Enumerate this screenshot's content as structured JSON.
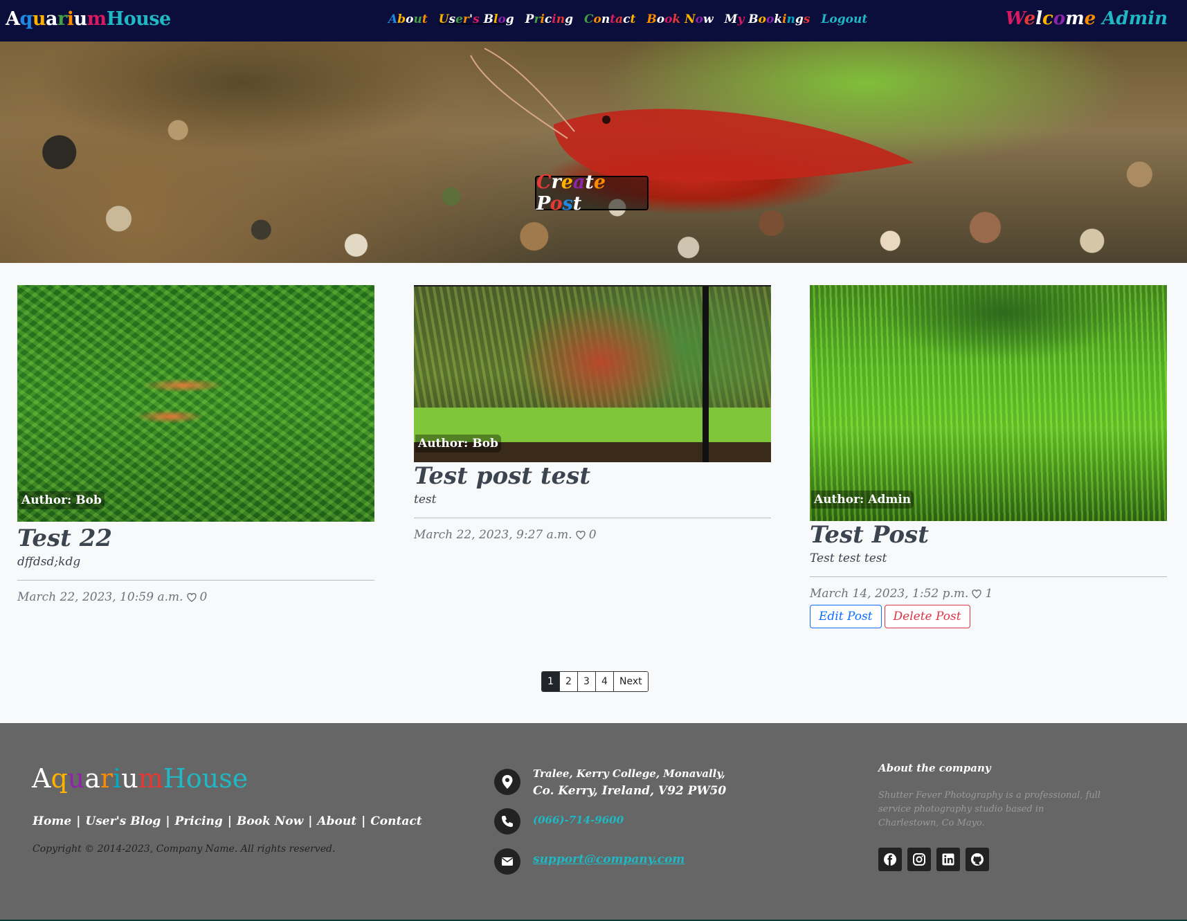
{
  "brand": {
    "part1": "Aquarium",
    "part2": "House"
  },
  "nav": {
    "items": [
      "About",
      "User's Blog",
      "Pricing",
      "Contact",
      "Book Now",
      "My Bookings",
      "Logout"
    ],
    "active_index": 1
  },
  "welcome": {
    "greeting": "Welcome",
    "user": "Admin"
  },
  "hero": {
    "create_post_label": "Create Post"
  },
  "posts": [
    {
      "author": "Author: Bob",
      "title": "Test 22",
      "excerpt": "dffdsd;kdg",
      "date": "March 22, 2023, 10:59 a.m.",
      "likes": "0"
    },
    {
      "author": "Author: Bob",
      "title": "Test post test",
      "excerpt": "test",
      "date": "March 22, 2023, 9:27 a.m.",
      "likes": "0"
    },
    {
      "author": "Author: Admin",
      "title": "Test Post",
      "excerpt": "Test test test",
      "date": "March 14, 2023, 1:52 p.m.",
      "likes": "1",
      "edit_label": "Edit Post",
      "delete_label": "Delete Post"
    }
  ],
  "pagination": {
    "pages": [
      "1",
      "2",
      "3",
      "4"
    ],
    "current": "1",
    "next_label": "Next"
  },
  "footer": {
    "logo": {
      "part1": "Aquarium",
      "part2": "House"
    },
    "links": [
      "Home",
      "User's Blog",
      "Pricing",
      "Book Now",
      "About",
      "Contact"
    ],
    "copyright": "Copyright © 2014-2023, Company Name. All rights reserved.",
    "address_line1": "Tralee, Kerry College, Monavally,",
    "address_line2": "Co. Kerry, Ireland, V92 PW50",
    "phone": "(066)-714-9600",
    "email": "support@company.com",
    "about_title": "About the company",
    "about_text": "Shutter Fever Photography is a professional, full service photography studio based in Charlestown, Co Mayo.",
    "social_icons": [
      "facebook-icon",
      "instagram-icon",
      "linkedin-icon",
      "github-icon"
    ]
  },
  "colors": {
    "navbar_bg": "#0b0e3a",
    "accent_teal": "#1fb8c4",
    "footer_bg": "#666666",
    "edit_blue": "#0d6efd",
    "delete_red": "#dc3545",
    "rainbow": [
      "#e53935",
      "#1e88e5",
      "#ffb300",
      "#8e24aa",
      "#43a047",
      "#fb8c00",
      "#00acc1",
      "#d81b60"
    ]
  }
}
